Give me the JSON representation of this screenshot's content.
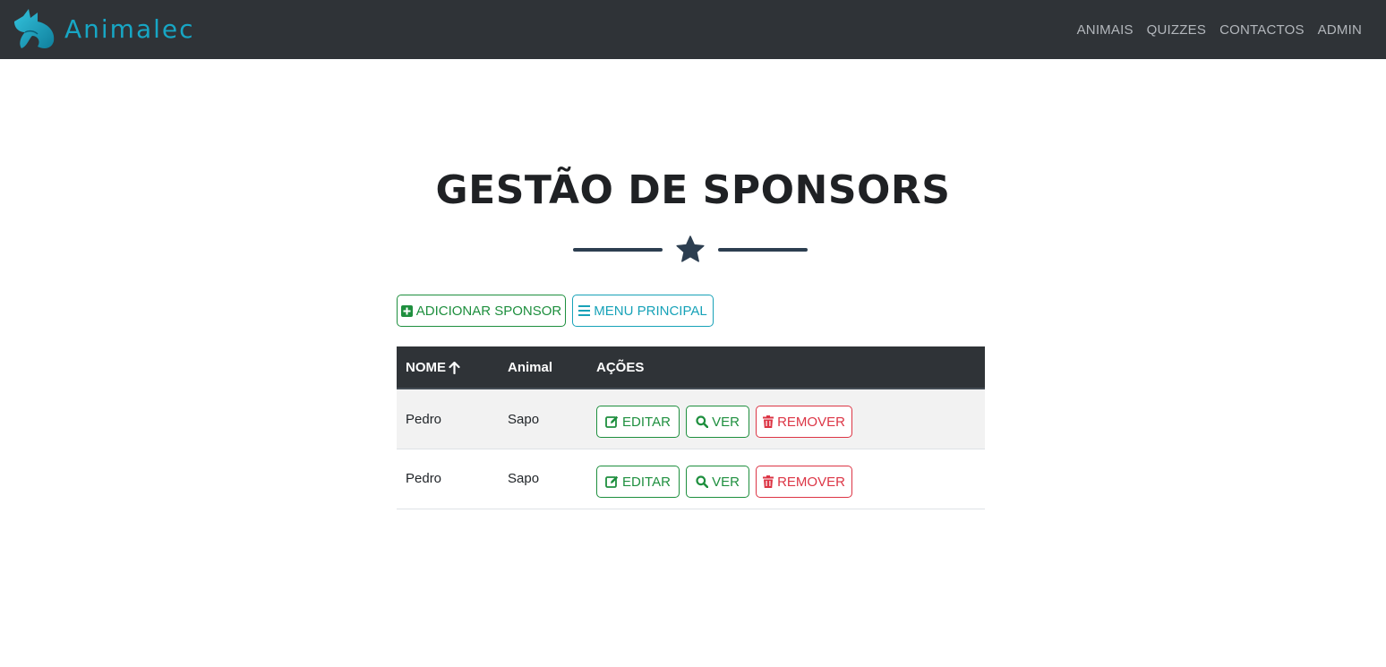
{
  "navbar": {
    "brand": "Animalec",
    "links": [
      "ANIMAIS",
      "QUIZZES",
      "CONTACTOS",
      "ADMIN"
    ]
  },
  "page": {
    "title": "GESTÃO DE SPONSORS"
  },
  "toolbar": {
    "add_label": "ADICIONAR SPONSOR",
    "menu_label": "MENU PRINCIPAL"
  },
  "table": {
    "headers": {
      "name": "NOME",
      "animal": "Animal",
      "actions": "AÇÕES"
    },
    "sort_icon": "arrow-up-icon",
    "rows": [
      {
        "name": "Pedro",
        "animal": "Sapo"
      },
      {
        "name": "Pedro",
        "animal": "Sapo"
      }
    ],
    "action_labels": {
      "edit": "EDITAR",
      "view": "VER",
      "remove": "REMOVER"
    }
  },
  "colors": {
    "navbar_bg": "#2f3337",
    "brand": "#17a6c4",
    "success": "#1e8f3e",
    "info": "#17a2b8",
    "danger": "#dc3545",
    "divider": "#2c3e50"
  }
}
